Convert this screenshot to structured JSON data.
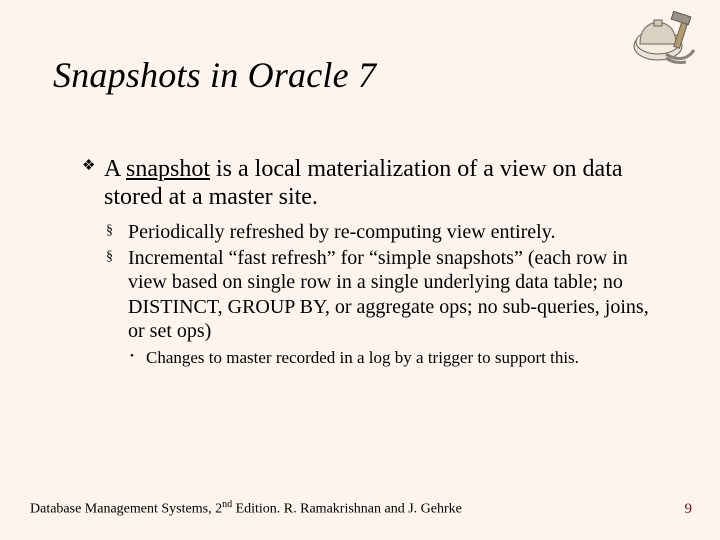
{
  "title": "Snapshots in Oracle 7",
  "body": {
    "b1_pre": "A ",
    "b1_snapshot": "snapshot",
    "b1_post": " is a local materialization of a view on data stored at a master site.",
    "b2a": "Periodically refreshed by re-computing view entirely.",
    "b2b": "Incremental “fast refresh” for “simple snapshots” (each row in view based on single row in a single underlying data table; no DISTINCT, GROUP BY, or aggregate ops; no sub-queries, joins, or set ops)",
    "b3": "Changes to master recorded in a log by a trigger to support this."
  },
  "footer": {
    "left_pre": "Database Management Systems, 2",
    "left_sup": "nd",
    "left_post": " Edition. R. Ramakrishnan and J. Gehrke",
    "page": "9"
  },
  "icons": {
    "decorative": "hardhat-hammer-icon"
  }
}
